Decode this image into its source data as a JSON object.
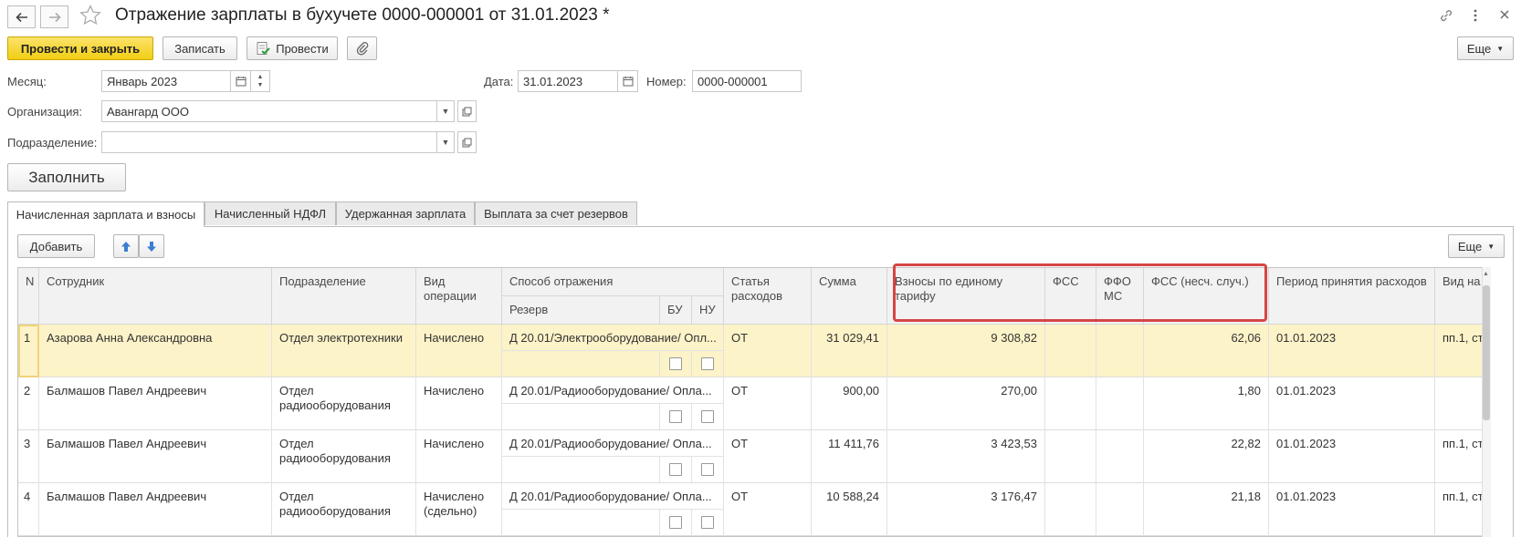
{
  "header": {
    "title": "Отражение зарплаты в бухучете 0000-000001 от 31.01.2023 *",
    "link_icon": "link-icon",
    "more_icon": "vertical-dots-icon",
    "close_icon": "close-icon"
  },
  "toolbar": {
    "post_close": "Провести и закрыть",
    "save": "Записать",
    "post": "Провести",
    "more": "Еще"
  },
  "form": {
    "month_label": "Месяц:",
    "month_value": "Январь 2023",
    "date_label": "Дата:",
    "date_value": "31.01.2023",
    "number_label": "Номер:",
    "number_value": "0000-000001",
    "org_label": "Организация:",
    "org_value": "Авангард ООО",
    "dept_label": "Подразделение:",
    "dept_value": "",
    "fill_button": "Заполнить"
  },
  "tabs": [
    {
      "label": "Начисленная зарплата и взносы",
      "active": true
    },
    {
      "label": "Начисленный НДФЛ",
      "active": false
    },
    {
      "label": "Удержанная зарплата",
      "active": false
    },
    {
      "label": "Выплата за счет резервов",
      "active": false
    }
  ],
  "table_toolbar": {
    "add": "Добавить",
    "more": "Еще"
  },
  "table": {
    "headers": {
      "n": "N",
      "employee": "Сотрудник",
      "department": "Подразделение",
      "operation": "Вид операции",
      "method": "Способ отражения",
      "reserve": "Резерв",
      "bu": "БУ",
      "nu": "НУ",
      "article": "Статья расходов",
      "sum": "Сумма",
      "contrib": "Взносы по единому тарифу",
      "fss": "ФСС",
      "ffoms": "ФФО МС",
      "fss_ns": "ФСС (несч. случ.)",
      "period": "Период принятия расходов",
      "kind": "Вид на"
    },
    "rows": [
      {
        "n": "1",
        "employee": "Азарова Анна Александровна",
        "department": "Отдел электротехники",
        "operation": "Начислено",
        "method": "Д 20.01/Электрооборудование/ Опл...",
        "article": "ОТ",
        "sum": "31 029,41",
        "contrib": "9 308,82",
        "fss": "",
        "ffoms": "",
        "fss_ns": "62,06",
        "period": "01.01.2023",
        "kind": "пп.1, ст",
        "selected": true
      },
      {
        "n": "2",
        "employee": "Балмашов Павел Андреевич",
        "department": "Отдел радиооборудования",
        "operation": "Начислено",
        "method": "Д 20.01/Радиооборудование/ Опла...",
        "article": "ОТ",
        "sum": "900,00",
        "contrib": "270,00",
        "fss": "",
        "ffoms": "",
        "fss_ns": "1,80",
        "period": "01.01.2023",
        "kind": "",
        "selected": false
      },
      {
        "n": "3",
        "employee": "Балмашов Павел Андреевич",
        "department": "Отдел радиооборудования",
        "operation": "Начислено",
        "method": "Д 20.01/Радиооборудование/ Опла...",
        "article": "ОТ",
        "sum": "11 411,76",
        "contrib": "3 423,53",
        "fss": "",
        "ffoms": "",
        "fss_ns": "22,82",
        "period": "01.01.2023",
        "kind": "пп.1, ст",
        "selected": false
      },
      {
        "n": "4",
        "employee": "Балмашов Павел Андреевич",
        "department": "Отдел радиооборудования",
        "operation": "Начислено (сдельно)",
        "method": "Д 20.01/Радиооборудование/ Опла...",
        "article": "ОТ",
        "sum": "10 588,24",
        "contrib": "3 176,47",
        "fss": "",
        "ffoms": "",
        "fss_ns": "21,18",
        "period": "01.01.2023",
        "kind": "пп.1, ст",
        "selected": false
      }
    ]
  },
  "colors": {
    "primary_button": "#f2ce14",
    "selected_row": "#fdf3c8",
    "highlight_frame": "#d64545",
    "arrow_blue": "#3a7fd0"
  }
}
